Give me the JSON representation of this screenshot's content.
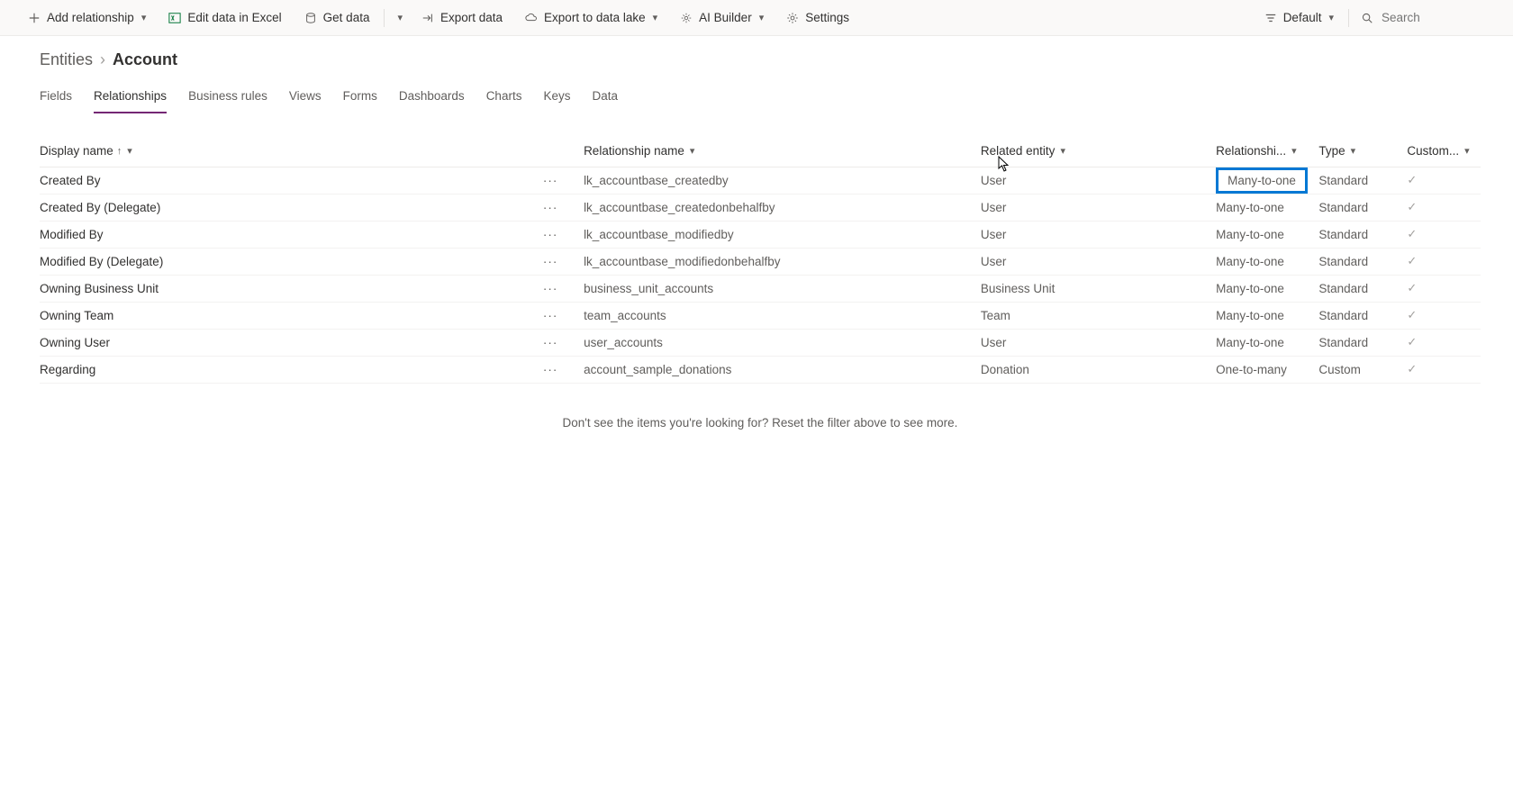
{
  "command_bar": {
    "add_relationship": "Add relationship",
    "edit_excel": "Edit data in Excel",
    "get_data": "Get data",
    "export_data": "Export data",
    "export_lake": "Export to data lake",
    "ai_builder": "AI Builder",
    "settings": "Settings",
    "view_default": "Default",
    "search_placeholder": "Search"
  },
  "breadcrumb": {
    "entities": "Entities",
    "current": "Account"
  },
  "tabs": [
    {
      "key": "fields",
      "label": "Fields"
    },
    {
      "key": "relationships",
      "label": "Relationships"
    },
    {
      "key": "business-rules",
      "label": "Business rules"
    },
    {
      "key": "views",
      "label": "Views"
    },
    {
      "key": "forms",
      "label": "Forms"
    },
    {
      "key": "dashboards",
      "label": "Dashboards"
    },
    {
      "key": "charts",
      "label": "Charts"
    },
    {
      "key": "keys",
      "label": "Keys"
    },
    {
      "key": "data",
      "label": "Data"
    }
  ],
  "active_tab": "relationships",
  "columns": {
    "display_name": "Display name",
    "relationship_name": "Relationship name",
    "related_entity": "Related entity",
    "relationship_type": "Relationshi...",
    "type": "Type",
    "customizable": "Custom..."
  },
  "rows": [
    {
      "display": "Created By",
      "relname": "lk_accountbase_createdby",
      "related": "User",
      "reltype": "Many-to-one",
      "type": "Standard",
      "custom": true,
      "highlight": true
    },
    {
      "display": "Created By (Delegate)",
      "relname": "lk_accountbase_createdonbehalfby",
      "related": "User",
      "reltype": "Many-to-one",
      "type": "Standard",
      "custom": true
    },
    {
      "display": "Modified By",
      "relname": "lk_accountbase_modifiedby",
      "related": "User",
      "reltype": "Many-to-one",
      "type": "Standard",
      "custom": true
    },
    {
      "display": "Modified By (Delegate)",
      "relname": "lk_accountbase_modifiedonbehalfby",
      "related": "User",
      "reltype": "Many-to-one",
      "type": "Standard",
      "custom": true
    },
    {
      "display": "Owning Business Unit",
      "relname": "business_unit_accounts",
      "related": "Business Unit",
      "reltype": "Many-to-one",
      "type": "Standard",
      "custom": true
    },
    {
      "display": "Owning Team",
      "relname": "team_accounts",
      "related": "Team",
      "reltype": "Many-to-one",
      "type": "Standard",
      "custom": true
    },
    {
      "display": "Owning User",
      "relname": "user_accounts",
      "related": "User",
      "reltype": "Many-to-one",
      "type": "Standard",
      "custom": true
    },
    {
      "display": "Regarding",
      "relname": "account_sample_donations",
      "related": "Donation",
      "reltype": "One-to-many",
      "type": "Custom",
      "custom": true
    }
  ],
  "empty_msg": "Don't see the items you're looking for? Reset the filter above to see more."
}
